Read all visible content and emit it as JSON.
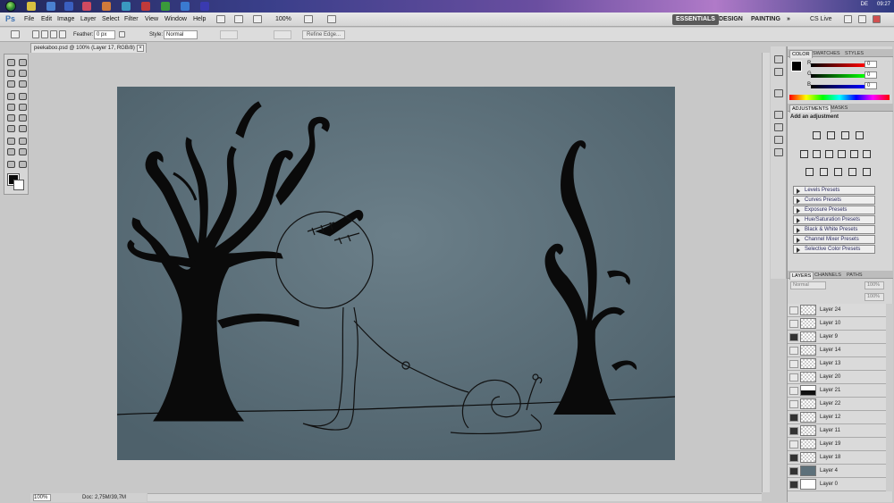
{
  "taskbar": {
    "clock": "09:27",
    "lang": "DE"
  },
  "menubar": {
    "logo": "Ps",
    "items": [
      "File",
      "Edit",
      "Image",
      "Layer",
      "Select",
      "Filter",
      "View",
      "Window",
      "Help"
    ],
    "zoom": "100%",
    "workspaces": [
      "ESSENTIALS",
      "DESIGN",
      "PAINTING"
    ],
    "more": "»",
    "cslive": "CS Live"
  },
  "options": {
    "feather_label": "Feather:",
    "feather_value": "0 px",
    "style_label": "Style:",
    "style_value": "Normal",
    "refine_edge": "Refine Edge..."
  },
  "document": {
    "tab_title": "peekaboo.psd @ 100% (Layer 17, RGB/8) *",
    "zoom": "100%",
    "doc_size": "Doc: 2,75M/39,7M"
  },
  "color_panel": {
    "tabs": [
      "COLOR",
      "SWATCHES",
      "STYLES"
    ],
    "r": "0",
    "g": "0",
    "b": "0",
    "r_label": "R",
    "g_label": "G",
    "b_label": "B"
  },
  "adjustments_panel": {
    "tabs": [
      "ADJUSTMENTS",
      "MASKS"
    ],
    "heading": "Add an adjustment",
    "presets": [
      "Levels Presets",
      "Curves Presets",
      "Exposure Presets",
      "Hue/Saturation Presets",
      "Black & White Presets",
      "Channel Mixer Presets",
      "Selective Color Presets"
    ]
  },
  "layers_panel": {
    "tabs": [
      "LAYERS",
      "CHANNELS",
      "PATHS"
    ],
    "blend_mode": "Normal",
    "opacity": "100%",
    "fill": "100%",
    "layers": [
      {
        "name": "Layer 24",
        "visible": false
      },
      {
        "name": "Layer 10",
        "visible": false
      },
      {
        "name": "Layer 9",
        "visible": true
      },
      {
        "name": "Layer 14",
        "visible": false
      },
      {
        "name": "Layer 13",
        "visible": false
      },
      {
        "name": "Layer 20",
        "visible": false
      },
      {
        "name": "Layer 21",
        "visible": false
      },
      {
        "name": "Layer 22",
        "visible": false
      },
      {
        "name": "Layer 12",
        "visible": true
      },
      {
        "name": "Layer 11",
        "visible": true
      },
      {
        "name": "Layer 19",
        "visible": false
      },
      {
        "name": "Layer 18",
        "visible": true
      },
      {
        "name": "Layer 4",
        "visible": true
      },
      {
        "name": "Layer 0",
        "visible": true
      }
    ]
  },
  "colors": {
    "canvas_bg": "#5d707a",
    "ink": "#0a0a0a",
    "accent": "#3a6fb0"
  }
}
